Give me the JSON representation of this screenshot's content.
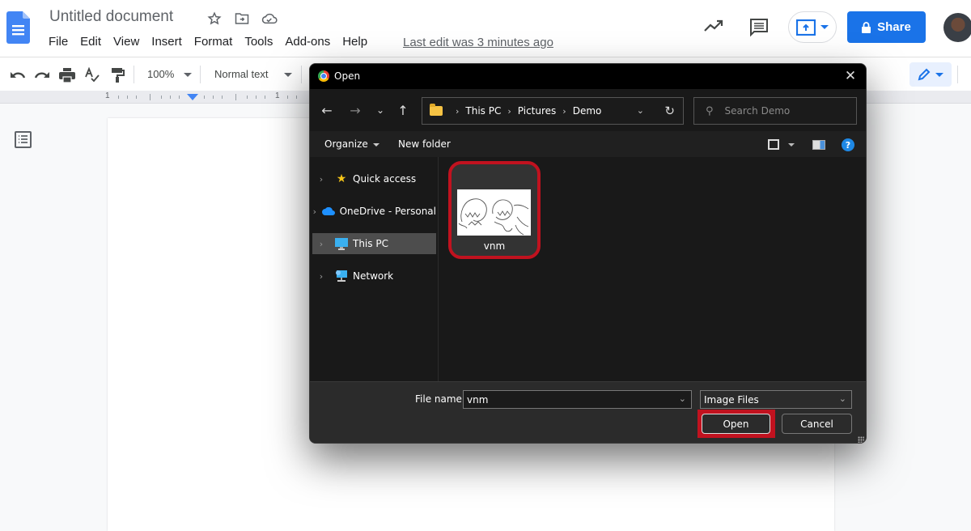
{
  "docs": {
    "title": "Untitled document",
    "menu": [
      "File",
      "Edit",
      "View",
      "Insert",
      "Format",
      "Tools",
      "Add-ons",
      "Help"
    ],
    "last_edit": "Last edit was 3 minutes ago",
    "share_label": "Share",
    "toolbar": {
      "zoom": "100%",
      "style": "Normal text"
    },
    "ruler_numbers": [
      "1",
      "1"
    ],
    "icons": {
      "star": "star-icon",
      "move": "move-to-folder-icon",
      "cloud": "cloud-saved-icon",
      "activity": "activity-trend-icon",
      "comments": "comment-history-icon",
      "present": "present-icon",
      "lock": "lock-icon",
      "pencil": "editing-mode-icon"
    },
    "colors": {
      "accent": "#1a73e8",
      "highlight": "#c1121f"
    }
  },
  "dialog": {
    "title": "Open",
    "breadcrumb": [
      "This PC",
      "Pictures",
      "Demo"
    ],
    "search_placeholder": "Search Demo",
    "commands": {
      "organize": "Organize",
      "new_folder": "New folder"
    },
    "nav_items": [
      {
        "label": "Quick access",
        "icon": "star-icon",
        "selected": false
      },
      {
        "label": "OneDrive - Personal",
        "icon": "cloud-icon",
        "selected": false
      },
      {
        "label": "This PC",
        "icon": "computer-icon",
        "selected": true
      },
      {
        "label": "Network",
        "icon": "network-icon",
        "selected": false
      }
    ],
    "files": [
      {
        "name": "vnm",
        "selected": true
      }
    ],
    "file_name_label": "File name:",
    "file_name_value": "vnm",
    "file_type": "Image Files",
    "open_label": "Open",
    "cancel_label": "Cancel"
  }
}
